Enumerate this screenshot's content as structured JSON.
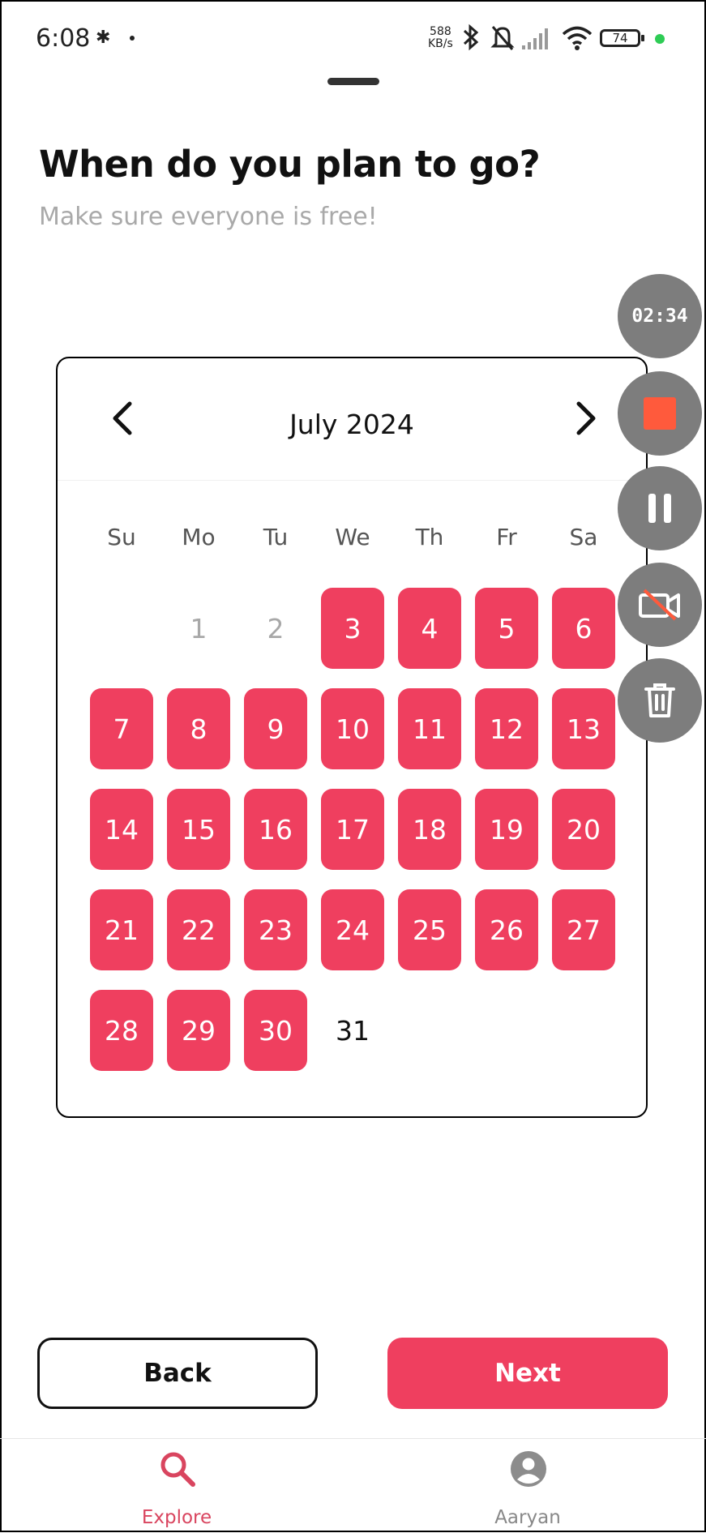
{
  "status_bar": {
    "time": "6:08",
    "net_speed_value": "588",
    "net_speed_unit": "KB/s",
    "battery": "74"
  },
  "recorder": {
    "timer": "02:34",
    "stop_color": "#ff5a3c"
  },
  "header": {
    "title": "When do you plan to go?",
    "subtitle": "Make sure everyone is free!"
  },
  "calendar": {
    "month_label": "July 2024",
    "weekdays": [
      "Su",
      "Mo",
      "Tu",
      "We",
      "Th",
      "Fr",
      "Sa"
    ],
    "days": [
      {
        "label": "1",
        "state": "past"
      },
      {
        "label": "2",
        "state": "past"
      },
      {
        "label": "3",
        "state": "selected"
      },
      {
        "label": "4",
        "state": "selected"
      },
      {
        "label": "5",
        "state": "selected"
      },
      {
        "label": "6",
        "state": "selected"
      },
      {
        "label": "7",
        "state": "selected"
      },
      {
        "label": "8",
        "state": "selected"
      },
      {
        "label": "9",
        "state": "selected"
      },
      {
        "label": "10",
        "state": "selected"
      },
      {
        "label": "11",
        "state": "selected"
      },
      {
        "label": "12",
        "state": "selected"
      },
      {
        "label": "13",
        "state": "selected"
      },
      {
        "label": "14",
        "state": "selected"
      },
      {
        "label": "15",
        "state": "selected"
      },
      {
        "label": "16",
        "state": "selected"
      },
      {
        "label": "17",
        "state": "selected"
      },
      {
        "label": "18",
        "state": "selected"
      },
      {
        "label": "19",
        "state": "selected"
      },
      {
        "label": "20",
        "state": "selected"
      },
      {
        "label": "21",
        "state": "selected"
      },
      {
        "label": "22",
        "state": "selected"
      },
      {
        "label": "23",
        "state": "selected"
      },
      {
        "label": "24",
        "state": "selected"
      },
      {
        "label": "25",
        "state": "selected"
      },
      {
        "label": "26",
        "state": "selected"
      },
      {
        "label": "27",
        "state": "selected"
      },
      {
        "label": "28",
        "state": "selected"
      },
      {
        "label": "29",
        "state": "selected"
      },
      {
        "label": "30",
        "state": "selected"
      },
      {
        "label": "31",
        "state": "available"
      }
    ],
    "first_weekday_index": 1,
    "selected_color": "#ef3f5f"
  },
  "actions": {
    "back_label": "Back",
    "next_label": "Next"
  },
  "bottom_nav": {
    "explore_label": "Explore",
    "profile_label": "Aaryan",
    "active_color": "#d9455f"
  }
}
